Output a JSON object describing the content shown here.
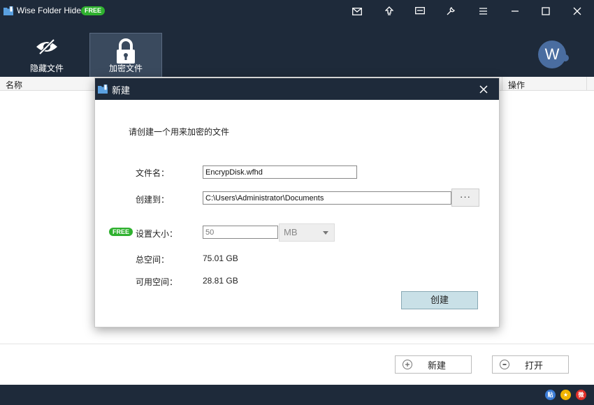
{
  "app": {
    "title": "Wise Folder Hider",
    "badge": "FREE"
  },
  "titlebar_buttons": [
    "mail-icon",
    "upload-icon",
    "display-icon",
    "tools-icon",
    "menu-icon",
    "minimize-icon",
    "maximize-icon",
    "close-icon"
  ],
  "nav": {
    "tabs": [
      {
        "label": "隐藏文件",
        "icon": "hidden-eye-icon",
        "active": false
      },
      {
        "label": "加密文件",
        "icon": "lock-icon",
        "active": true
      }
    ]
  },
  "user": {
    "avatar_letter": "W"
  },
  "list": {
    "columns": [
      "名称",
      "操作"
    ]
  },
  "bottom": {
    "new_label": "新建",
    "open_label": "打开"
  },
  "status_icons": [
    "tieba-icon",
    "star-icon",
    "weibo-icon"
  ],
  "dialog": {
    "title": "新建",
    "prompt": "请创建一个用来加密的文件",
    "filename_label": "文件名：",
    "filename_value": "EncrypDisk.wfhd",
    "location_label": "创建到：",
    "location_value": "C:\\Users\\Administrator\\Documents",
    "browse_label": "···",
    "free_badge": "FREE",
    "size_label": "设置大小：",
    "size_value": "50",
    "size_unit": "MB",
    "total_label": "总空间：",
    "total_value": "75.01 GB",
    "free_label": "可用空间：",
    "free_value": "28.81 GB",
    "create_label": "创建"
  },
  "colors": {
    "header_bg": "#1e2a3a",
    "accent_green": "#2fb12f",
    "create_btn": "#c9e0e7"
  }
}
